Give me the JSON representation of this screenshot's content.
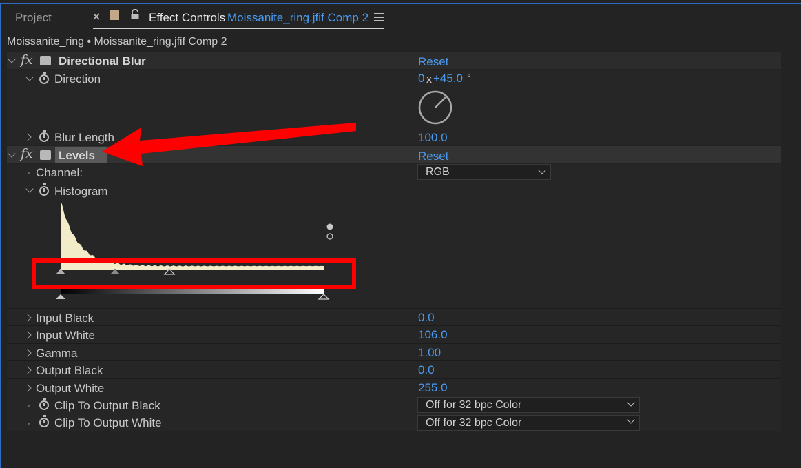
{
  "tabs": {
    "project": "Project",
    "effect_controls": "Effect Controls",
    "comp_name": "Moissanite_ring.jfif Comp 2"
  },
  "breadcrumb": "Moissanite_ring • Moissanite_ring.jfif Comp 2",
  "effects": {
    "directional_blur": {
      "name": "Directional Blur",
      "reset": "Reset",
      "direction_label": "Direction",
      "direction_revolutions": "0",
      "direction_x": "x",
      "direction_degrees": "+45.0",
      "direction_unit": "°",
      "blur_length_label": "Blur Length",
      "blur_length_value": "100.0"
    },
    "levels": {
      "name": "Levels",
      "reset": "Reset",
      "channel_label": "Channel:",
      "channel_value": "RGB",
      "histogram_label": "Histogram",
      "properties": [
        {
          "label": "Input Black",
          "value": "0.0"
        },
        {
          "label": "Input White",
          "value": "106.0"
        },
        {
          "label": "Gamma",
          "value": "1.00"
        },
        {
          "label": "Output Black",
          "value": "0.0"
        },
        {
          "label": "Output White",
          "value": "255.0"
        }
      ],
      "clip_black_label": "Clip To Output Black",
      "clip_black_value": "Off for 32 bpc Color",
      "clip_white_label": "Clip To Output White",
      "clip_white_value": "Off for 32 bpc Color"
    }
  },
  "colors": {
    "accent_blue": "#4a9bf0",
    "annotation_red": "#ff0000",
    "histogram_fill": "#f2ecc8"
  },
  "icons": {
    "close": "close-icon",
    "lock": "lock-icon",
    "menu": "hamburger-menu-icon",
    "stopwatch": "stopwatch-icon",
    "fx": "fx-icon"
  }
}
